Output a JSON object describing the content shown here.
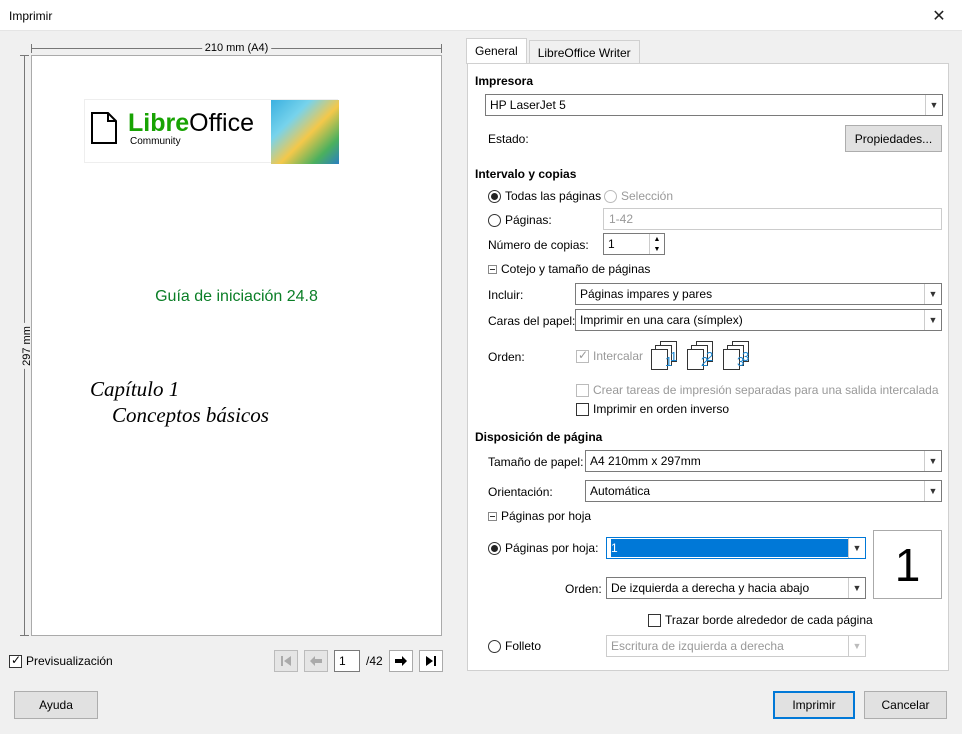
{
  "window": {
    "title": "Imprimir",
    "close_symbol": "✕"
  },
  "preview": {
    "width_label": "210 mm (A4)",
    "height_label": "297 mm",
    "brand_green": "Libre",
    "brand_black": "Office",
    "brand_sub": "Community",
    "guide_title": "Guía de iniciación 24.8",
    "chapter_line1": "Capítulo 1",
    "chapter_line2": "Conceptos básicos",
    "guide_color": "#0a7e26"
  },
  "footer_left": {
    "preview_label": "Previsualización",
    "current_page": "1",
    "total_pages": "/42"
  },
  "tabs": [
    {
      "label": "General"
    },
    {
      "label": "LibreOffice Writer"
    }
  ],
  "printer": {
    "section": "Impresora",
    "selected": "HP LaserJet 5",
    "status_label": "Estado:",
    "properties_button": "Propiedades..."
  },
  "range": {
    "section": "Intervalo y copias",
    "all_pages": "Todas las páginas",
    "selection": "Selección",
    "pages": "Páginas:",
    "pages_placeholder": "1-42",
    "copies_label": "Número de copias:",
    "copies_value": "1",
    "collate_group": "Cotejo y tamaño de páginas",
    "include_label": "Incluir:",
    "include_value": "Páginas impares y pares",
    "sides_label": "Caras del papel:",
    "sides_value": "Imprimir en una cara (símplex)",
    "order_label": "Orden:",
    "collate": "Intercalar",
    "separate_jobs": "Crear tareas de impresión separadas para una salida intercalada",
    "reverse": "Imprimir en orden inverso"
  },
  "layout": {
    "section": "Disposición de página",
    "paper_size_label": "Tamaño de papel:",
    "paper_size_value": "A4 210mm x 297mm",
    "orientation_label": "Orientación:",
    "orientation_value": "Automática",
    "pps_group": "Páginas por hoja",
    "pps_label": "Páginas por hoja:",
    "pps_value": "1",
    "order_label": "Orden:",
    "order_value": "De izquierda a derecha y hacia abajo",
    "border": "Trazar borde alrededor de cada página",
    "brochure": "Folleto",
    "brochure_value": "Escritura de izquierda a derecha",
    "nup_preview": "1"
  },
  "buttons": {
    "help": "Ayuda",
    "print": "Imprimir",
    "cancel": "Cancelar"
  }
}
